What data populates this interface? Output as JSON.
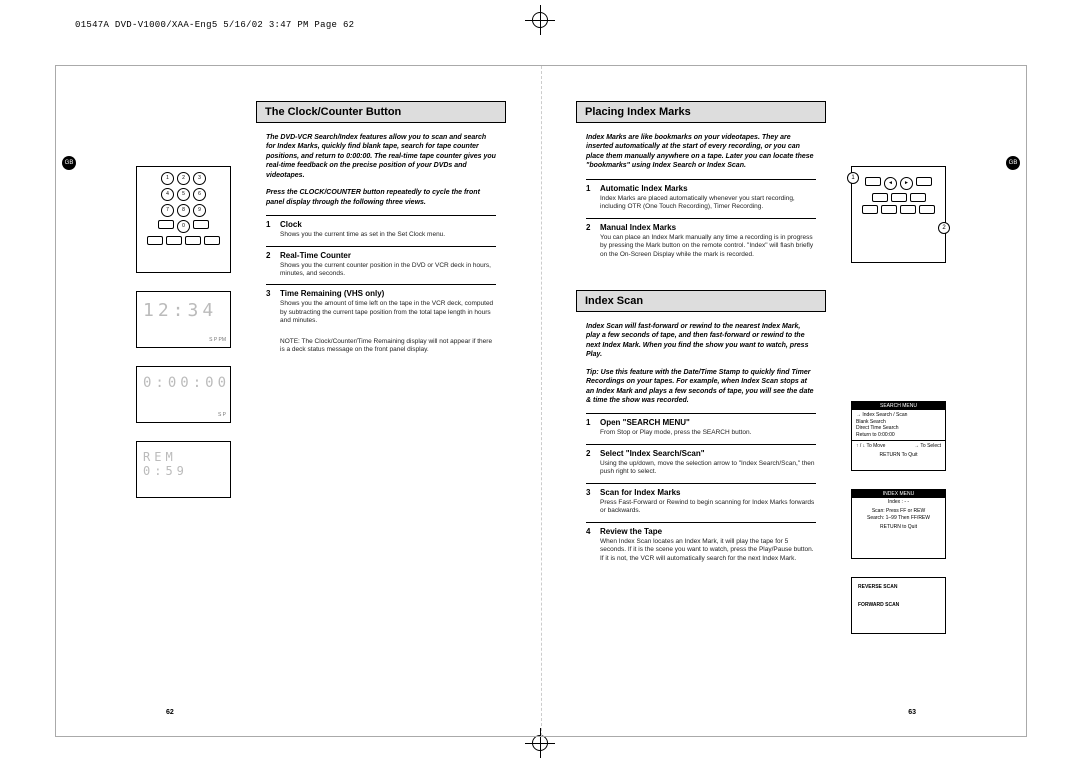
{
  "header": "01547A DVD-V1000/XAA-Eng5  5/16/02 3:47 PM  Page 62",
  "gb_label": "GB",
  "page_left_num": "62",
  "page_right_num": "63",
  "left": {
    "title": "The Clock/Counter Button",
    "intro1": "The DVD-VCR Search/Index features allow you to scan and search for Index Marks, quickly find blank tape, search for tape counter positions, and return to 0:00:00. The real-time tape counter gives you real-time feedback on the precise position of your DVDs and videotapes.",
    "intro2": "Press the CLOCK/COUNTER button repeatedly to cycle the front panel display through the following three views.",
    "steps": [
      {
        "n": "1",
        "t": "Clock",
        "d": "Shows you the current time as set in the Set Clock menu."
      },
      {
        "n": "2",
        "t": "Real-Time Counter",
        "d": "Shows you the current counter position in the DVD or VCR deck in hours, minutes, and seconds."
      },
      {
        "n": "3",
        "t": "Time Remaining (VHS only)",
        "d": "Shows you the amount of time left on the tape in the VCR deck, computed by subtracting the current tape position from the total tape length in hours and minutes."
      }
    ],
    "note": "NOTE: The Clock/Counter/Time Remaining display will not appear if there is a deck status message on the front panel display.",
    "display1": "12:34",
    "display1_sub": "S P\nPM",
    "display2": "0:00:00",
    "display2_sub": "S P",
    "display3": "REM 0:59"
  },
  "right": {
    "title1": "Placing Index Marks",
    "intro1": "Index Marks are like bookmarks on your videotapes. They are inserted automatically at the start of every recording, or you can place them manually anywhere on a tape. Later you can locate these \"bookmarks\" using Index Search or Index Scan.",
    "steps1": [
      {
        "n": "1",
        "t": "Automatic Index Marks",
        "d": "Index Marks are placed automatically whenever you start recording, including OTR (One Touch Recording), Timer Recording."
      },
      {
        "n": "2",
        "t": "Manual Index Marks",
        "d": "You can place an Index Mark manually any time a recording is in progress by pressing the Mark button on the remote control. \"Index\" will flash briefly on the On-Screen Display while the mark is recorded."
      }
    ],
    "title2": "Index Scan",
    "intro2a": "Index Scan will fast-forward or rewind to the nearest Index Mark, play a few seconds of tape, and then fast-forward or rewind to the next Index Mark. When you find the show you want to watch, press Play.",
    "intro2b": "Tip: Use this feature with the Date/Time Stamp to quickly find Timer Recordings on your tapes. For example, when Index Scan stops at an Index Mark and plays a few seconds of tape, you will see the date & time the show was recorded.",
    "steps2": [
      {
        "n": "1",
        "t": "Open \"SEARCH MENU\"",
        "d": "From Stop or Play mode, press the SEARCH button."
      },
      {
        "n": "2",
        "t": "Select \"Index Search/Scan\"",
        "d": "Using the up/down, move the selection arrow to \"Index Search/Scan,\" then push right to select."
      },
      {
        "n": "3",
        "t": "Scan for Index Marks",
        "d": "Press Fast-Forward or Rewind to begin scanning for Index Marks forwards or backwards."
      },
      {
        "n": "4",
        "t": "Review the Tape",
        "d": "When Index Scan locates an Index Mark, it will play the tape for 5 seconds. If it is the scene you want to watch, press the Play/Pause button. If it is not, the VCR will automatically search for the next Index Mark."
      }
    ],
    "osd1": {
      "header": "SEARCH MENU",
      "lines": [
        "→ Index Search / Scan",
        "Blank Search",
        "Direct Time Search",
        "Return to 0:00:00"
      ],
      "footer_l": "↑ / ↓  To Move",
      "footer_r": "→ To Select",
      "footer_c": "RETURN To Quit"
    },
    "osd2": {
      "header": "INDEX MENU",
      "line1": "Index :  - -",
      "line2": "Scan:     Press FF or REW",
      "line3": "Search:   1–99 Then FF/REW",
      "footer_c": "RETURN  to   Quit"
    },
    "osd3": {
      "l1": "REVERSE SCAN",
      "l2": "FORWARD SCAN"
    }
  }
}
